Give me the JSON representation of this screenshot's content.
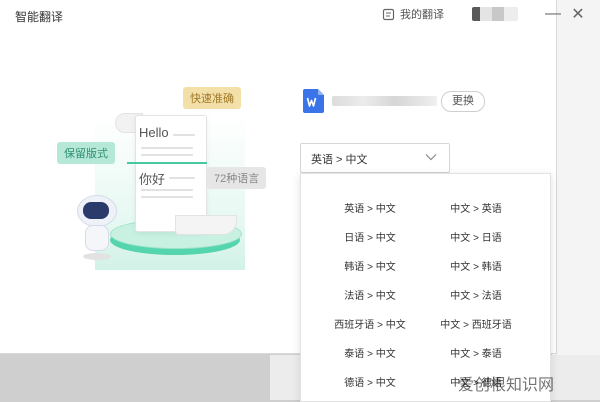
{
  "window": {
    "title": "智能翻译",
    "my_translations": "我的翻译",
    "minimize_glyph": "—",
    "close_glyph": "✕"
  },
  "illustration": {
    "bubble_fast": "快速准确",
    "bubble_keep": "保留版式",
    "bubble_lang": "72种语言",
    "paper_en": "Hello",
    "paper_zh": "你好"
  },
  "file": {
    "icon": "word-document-icon",
    "change_label": "更换"
  },
  "language_select": {
    "value": "英语 > 中文"
  },
  "dropdown": {
    "options": [
      [
        "英语 > 中文",
        "中文 > 英语"
      ],
      [
        "日语 > 中文",
        "中文 > 日语"
      ],
      [
        "韩语 > 中文",
        "中文 > 韩语"
      ],
      [
        "法语 > 中文",
        "中文 > 法语"
      ],
      [
        "西班牙语 > 中文",
        "中文 > 西班牙语"
      ],
      [
        "泰语 > 中文",
        "中文 > 泰语"
      ],
      [
        "德语 > 中文",
        "中文 > 德语"
      ]
    ]
  },
  "watermark": "爱创根知识网",
  "colors": {
    "accent_green": "#46c9a0",
    "word_blue": "#3b74e8"
  }
}
